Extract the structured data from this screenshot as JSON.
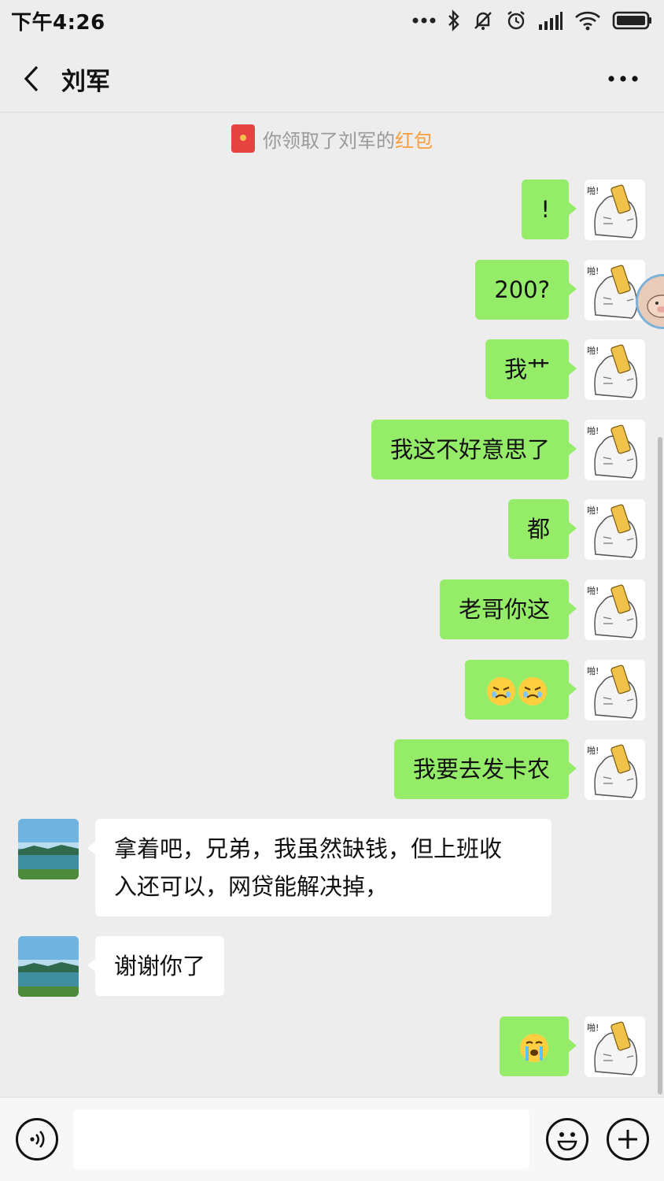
{
  "status_bar": {
    "time": "下午4:26"
  },
  "header": {
    "title": "刘军"
  },
  "notice": {
    "prefix": "你领取了刘军的",
    "link": "红包"
  },
  "messages": [
    {
      "from": "me",
      "text": "!"
    },
    {
      "from": "me",
      "text": "200?"
    },
    {
      "from": "me",
      "text": "我艹"
    },
    {
      "from": "me",
      "text": "我这不好意思了"
    },
    {
      "from": "me",
      "text": "都"
    },
    {
      "from": "me",
      "text": "老哥你这"
    },
    {
      "from": "me",
      "emoji": [
        "sad-face",
        "sad-face"
      ]
    },
    {
      "from": "me",
      "text": "我要去发卡农"
    },
    {
      "from": "friend",
      "text": "拿着吧，兄弟，我虽然缺钱，但上班收入还可以，网贷能解决掉，",
      "lines": [
        "拿着吧，兄弟，我虽然缺钱，但上班收",
        "入还可以，网贷能解决掉，"
      ]
    },
    {
      "from": "friend",
      "text": "谢谢你了"
    },
    {
      "from": "me",
      "emoji": [
        "crying-face"
      ]
    }
  ],
  "colors": {
    "background": "#ededed",
    "my_bubble": "#95ec69",
    "friend_bubble": "#ffffff",
    "notice_link": "#fa9d3b"
  },
  "input_bar": {
    "value": ""
  }
}
